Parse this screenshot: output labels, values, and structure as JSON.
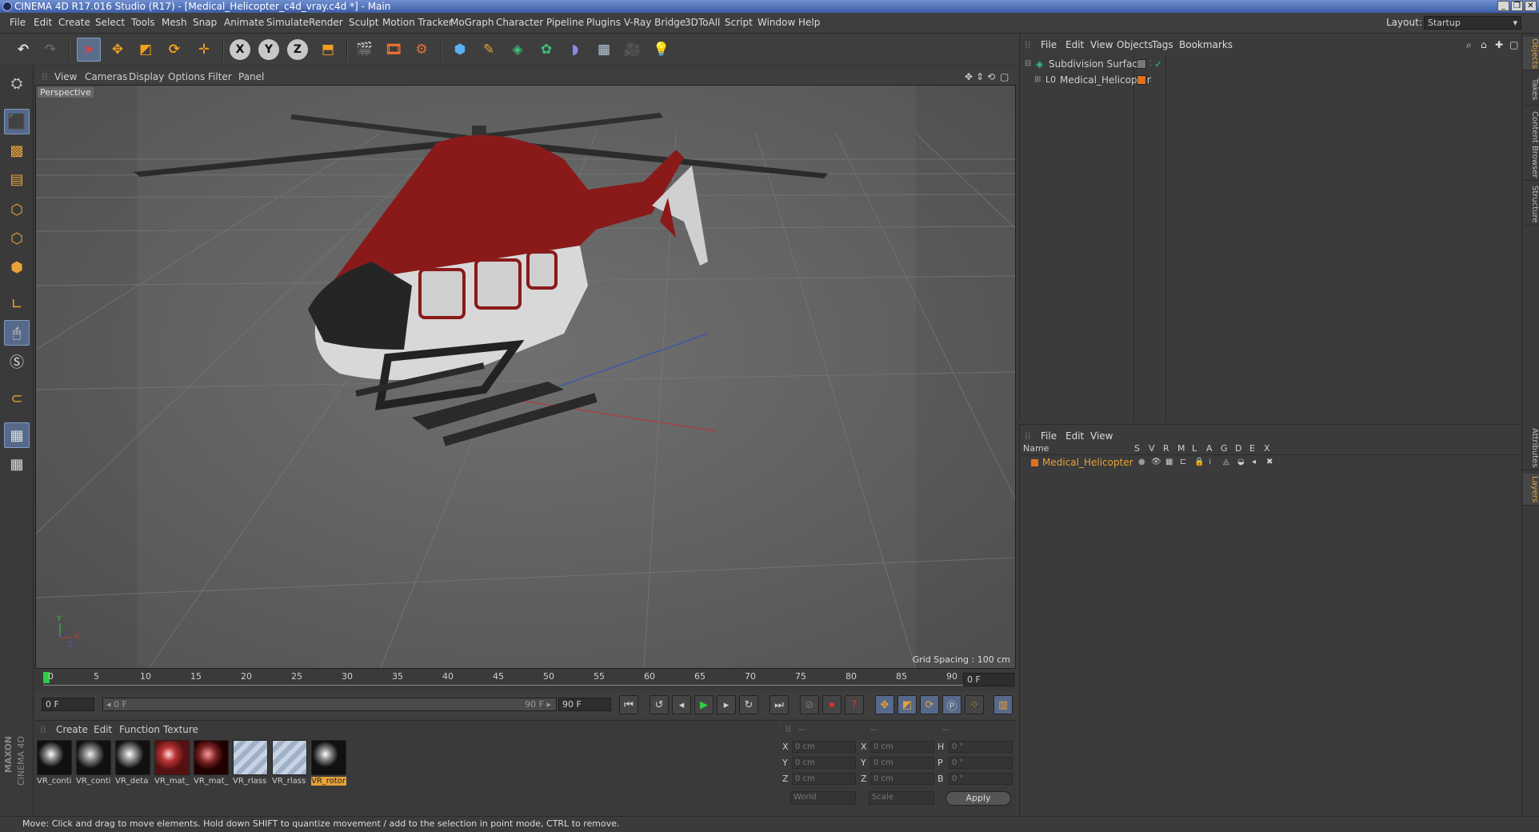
{
  "window": {
    "title": "CINEMA 4D R17.016 Studio (R17) - [Medical_Helicopter_c4d_vray.c4d *] - Main",
    "controls": [
      "_",
      "❐",
      "✕"
    ]
  },
  "menubar": {
    "items": [
      "File",
      "Edit",
      "Create",
      "Select",
      "Tools",
      "Mesh",
      "Snap",
      "Animate",
      "Simulate",
      "Render",
      "Sculpt",
      "Motion Tracker",
      "MoGraph",
      "Character",
      "Pipeline",
      "Plugins",
      "V-Ray Bridge",
      "3DToAll",
      "Script",
      "Window",
      "Help"
    ],
    "layout_label": "Layout:",
    "layout_value": "Startup"
  },
  "toolbar": {
    "axis_x": "X",
    "axis_y": "Y",
    "axis_z": "Z"
  },
  "viewport": {
    "menu": [
      "View",
      "Cameras",
      "Display",
      "Options",
      "Filter",
      "Panel"
    ],
    "label": "Perspective",
    "grid_spacing": "Grid Spacing : 100 cm",
    "axis_labels": {
      "y": "Y",
      "x": "X",
      "z": "Z"
    }
  },
  "timeline": {
    "ticks": [
      "0",
      "5",
      "10",
      "15",
      "20",
      "25",
      "30",
      "35",
      "40",
      "45",
      "50",
      "55",
      "60",
      "65",
      "70",
      "75",
      "80",
      "85",
      "90"
    ],
    "current_frame": "0 F"
  },
  "transport": {
    "start_field": "0 F",
    "range_start": "◂ 0 F",
    "range_end": "90 F ▸",
    "end_field": "90 F"
  },
  "materials": {
    "menu": [
      "Create",
      "Edit",
      "Function",
      "Texture"
    ],
    "items": [
      {
        "label": "VR_conti",
        "kind": "dark"
      },
      {
        "label": "VR_conti",
        "kind": "dark"
      },
      {
        "label": "VR_deta",
        "kind": "dark"
      },
      {
        "label": "VR_mat_",
        "kind": "red"
      },
      {
        "label": "VR_mat_",
        "kind": "darkred"
      },
      {
        "label": "VR_rlass",
        "kind": "glass"
      },
      {
        "label": "VR_rlass",
        "kind": "glass"
      },
      {
        "label": "VR_rotor",
        "kind": "dark",
        "selected": true
      }
    ],
    "brand_top": "MAXON",
    "brand_bottom": "CINEMA 4D"
  },
  "coordinates": {
    "headers": [
      "--",
      "--",
      "--"
    ],
    "rows": [
      {
        "a": "X",
        "av": "0 cm",
        "b": "X",
        "bv": "0 cm",
        "c": "H",
        "cv": "0 °"
      },
      {
        "a": "Y",
        "av": "0 cm",
        "b": "Y",
        "bv": "0 cm",
        "c": "P",
        "cv": "0 °"
      },
      {
        "a": "Z",
        "av": "0 cm",
        "b": "Z",
        "bv": "0 cm",
        "c": "B",
        "cv": "0 °"
      }
    ],
    "mode1": "World",
    "mode2": "Scale",
    "apply": "Apply"
  },
  "status": {
    "text": "Move: Click and drag to move elements. Hold down SHIFT to quantize movement / add to the selection in point mode, CTRL to remove."
  },
  "object_manager": {
    "menu": [
      "File",
      "Edit",
      "View",
      "Objects",
      "Tags",
      "Bookmarks"
    ],
    "objects": [
      {
        "name": "Subdivision Surface",
        "check": "✓"
      },
      {
        "name": "Medical_Helicopter"
      }
    ]
  },
  "layer_manager": {
    "menu": [
      "File",
      "Edit",
      "View"
    ],
    "header_name": "Name",
    "columns": [
      "S",
      "V",
      "R",
      "M",
      "L",
      "A",
      "G",
      "D",
      "E",
      "X"
    ],
    "layers": [
      {
        "name": "Medical_Helicopter",
        "color": "#e0701e"
      }
    ]
  },
  "side_tabs": [
    "Objects",
    "Takes",
    "Content Browser",
    "Structure",
    "Attributes",
    "Layers"
  ],
  "colors": {
    "accent": "#e8a23a",
    "selection": "#5a6e8c",
    "layer": "#e0701e"
  }
}
